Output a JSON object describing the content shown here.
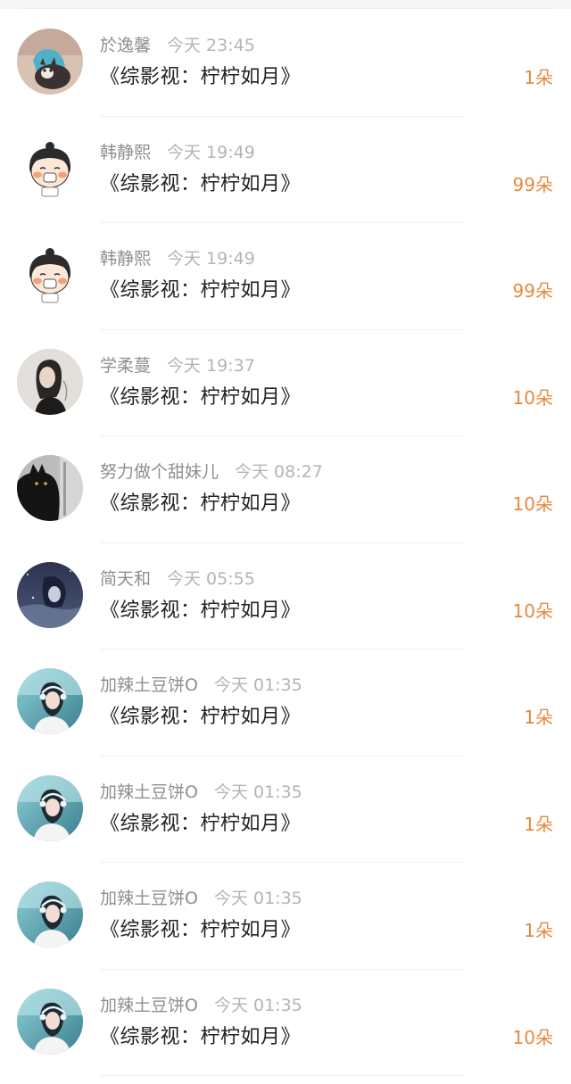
{
  "rows": [
    {
      "name": "於逸馨",
      "time": "今天 23:45",
      "title": "《综影视：柠柠如月》",
      "count": "1朵",
      "avatar": "cat-photo-avatar"
    },
    {
      "name": "韩静熙",
      "time": "今天 19:49",
      "title": "《综影视：柠柠如月》",
      "count": "99朵",
      "avatar": "cartoon-girl-avatar"
    },
    {
      "name": "韩静熙",
      "time": "今天 19:49",
      "title": "《综影视：柠柠如月》",
      "count": "99朵",
      "avatar": "cartoon-girl-avatar"
    },
    {
      "name": "学柔蔓",
      "time": "今天 19:37",
      "title": "《综影视：柠柠如月》",
      "count": "10朵",
      "avatar": "girl-photo-avatar"
    },
    {
      "name": "努力做个甜妹儿",
      "time": "今天 08:27",
      "title": "《综影视：柠柠如月》",
      "count": "10朵",
      "avatar": "black-cat-avatar"
    },
    {
      "name": "简天和",
      "time": "今天 05:55",
      "title": "《综影视：柠柠如月》",
      "count": "10朵",
      "avatar": "anime-night-avatar"
    },
    {
      "name": "加辣土豆饼O",
      "time": "今天 01:35",
      "title": "《综影视：柠柠如月》",
      "count": "1朵",
      "avatar": "headphone-girl-avatar"
    },
    {
      "name": "加辣土豆饼O",
      "time": "今天 01:35",
      "title": "《综影视：柠柠如月》",
      "count": "1朵",
      "avatar": "headphone-girl-avatar"
    },
    {
      "name": "加辣土豆饼O",
      "time": "今天 01:35",
      "title": "《综影视：柠柠如月》",
      "count": "1朵",
      "avatar": "headphone-girl-avatar"
    },
    {
      "name": "加辣土豆饼O",
      "time": "今天 01:35",
      "title": "《综影视：柠柠如月》",
      "count": "10朵",
      "avatar": "headphone-girl-avatar"
    }
  ],
  "colors": {
    "count_accent": "#e8883e",
    "name_gray": "#8f8f8f",
    "time_gray": "#b4b4b4",
    "title_text": "#222222"
  }
}
